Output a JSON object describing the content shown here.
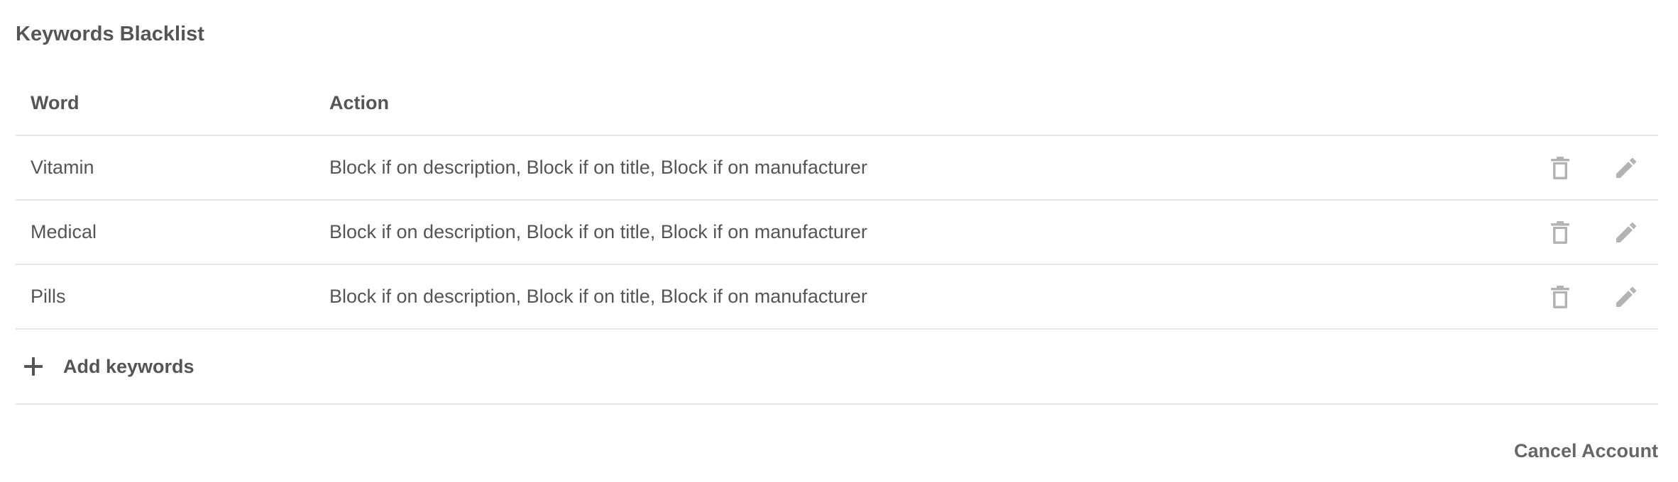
{
  "section": {
    "title": "Keywords Blacklist"
  },
  "table": {
    "columns": {
      "word": "Word",
      "action": "Action"
    },
    "rows": [
      {
        "word": "Vitamin",
        "action": "Block if on description, Block if on title, Block if on manufacturer"
      },
      {
        "word": "Medical",
        "action": "Block if on description, Block if on title, Block if on manufacturer"
      },
      {
        "word": "Pills",
        "action": "Block if on description, Block if on title, Block if on manufacturer"
      }
    ],
    "row_icons": [
      "trash-icon",
      "pencil-icon"
    ]
  },
  "add": {
    "label": "Add keywords",
    "icon": "plus-icon"
  },
  "footer": {
    "cancel_label": "Cancel Account"
  },
  "colors": {
    "text": "#555555",
    "icon": "#b3b3b3",
    "divider": "#e5e5e5"
  }
}
